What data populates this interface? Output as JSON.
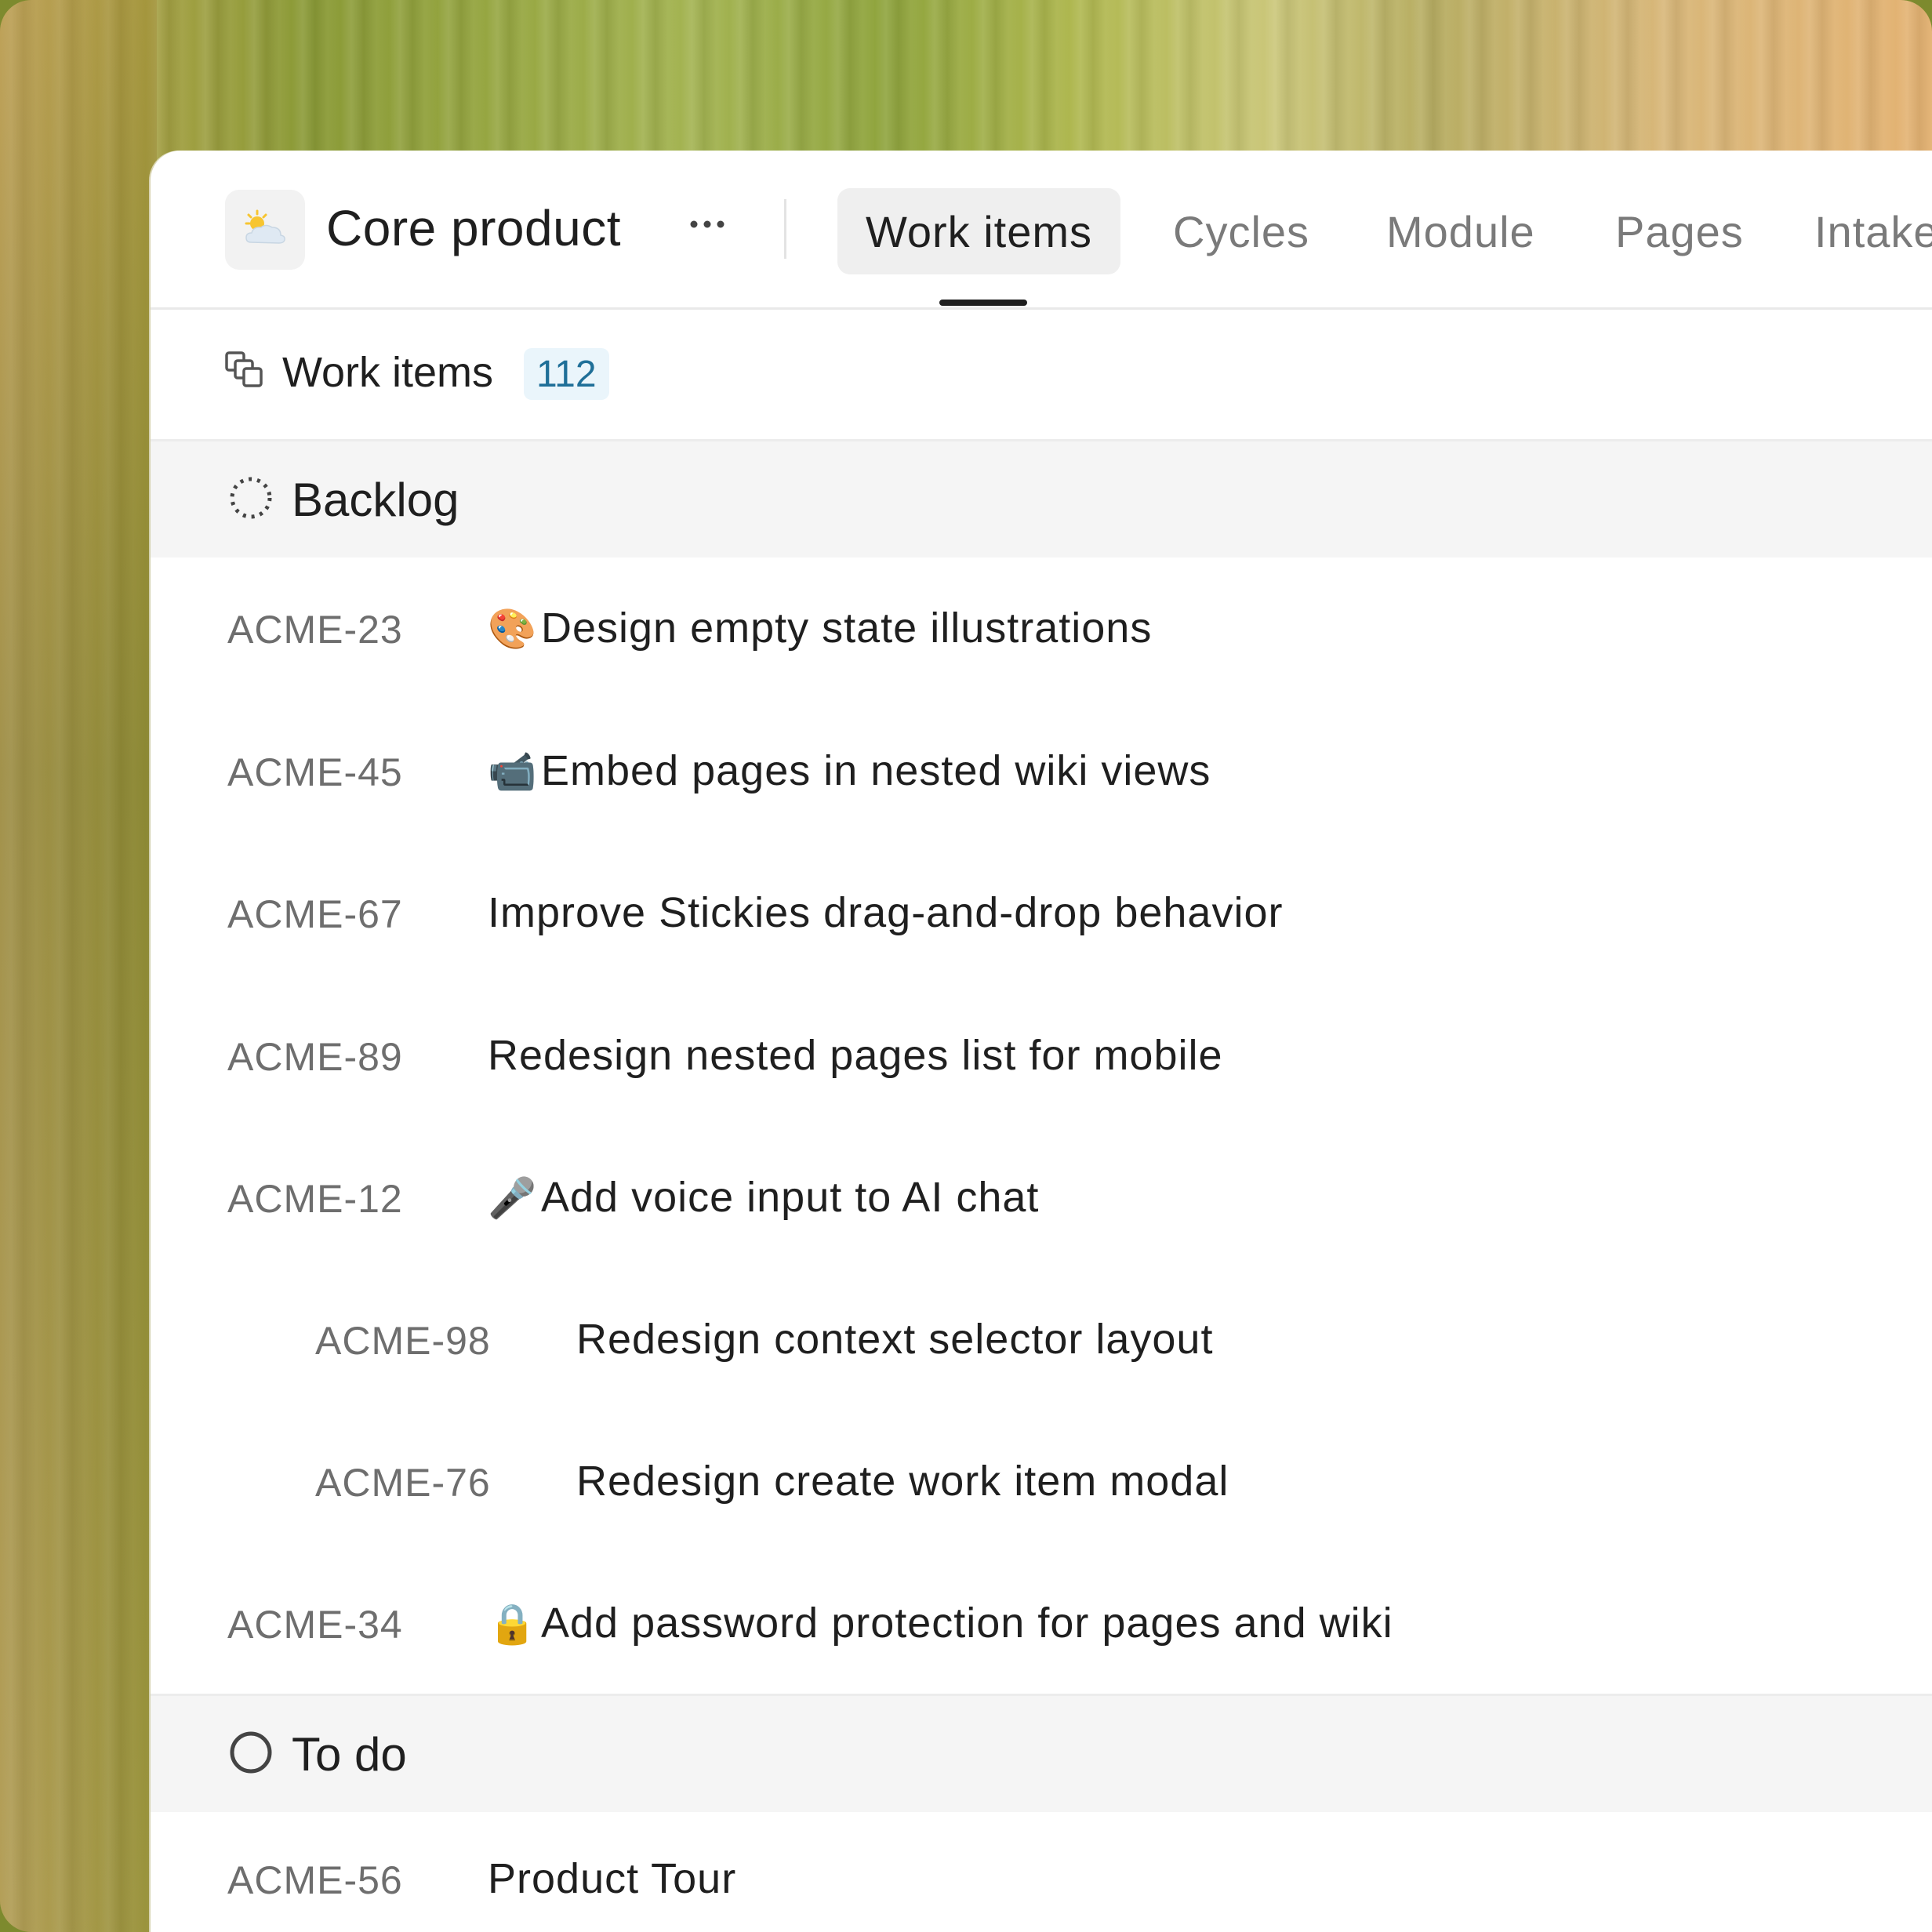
{
  "project": {
    "icon": "sun-behind-cloud-icon",
    "name": "Core product",
    "more_label": "···"
  },
  "tabs": [
    {
      "label": "Work items",
      "active": true
    },
    {
      "label": "Cycles",
      "active": false
    },
    {
      "label": "Module",
      "active": false
    },
    {
      "label": "Pages",
      "active": false
    },
    {
      "label": "Intake",
      "active": false
    }
  ],
  "work_items": {
    "icon": "layers-icon",
    "title": "Work items",
    "count": "112"
  },
  "groups": [
    {
      "name": "Backlog",
      "icon": "dashed-circle-icon",
      "items": [
        {
          "id": "ACME-23",
          "emoji": "🎨",
          "emoji_name": "palette-icon",
          "title": "Design empty state illustrations",
          "level": 0
        },
        {
          "id": "ACME-45",
          "emoji": "📹",
          "emoji_name": "video-camera-icon",
          "title": "Embed pages in nested wiki views",
          "level": 0
        },
        {
          "id": "ACME-67",
          "emoji": "",
          "title": "Improve Stickies drag-and-drop behavior",
          "level": 0
        },
        {
          "id": "ACME-89",
          "emoji": "",
          "title": "Redesign nested pages list for mobile",
          "level": 0
        },
        {
          "id": "ACME-12",
          "emoji": "🎤",
          "emoji_name": "microphone-icon",
          "title": "Add voice input to AI chat",
          "level": 0
        },
        {
          "id": "ACME-98",
          "emoji": "",
          "title": "Redesign context selector layout",
          "level": 1
        },
        {
          "id": "ACME-76",
          "emoji": "",
          "title": "Redesign create work item modal",
          "level": 1
        },
        {
          "id": "ACME-34",
          "emoji": "🔒",
          "emoji_name": "lock-icon",
          "title": "Add password protection for pages and wiki",
          "level": 0
        }
      ]
    },
    {
      "name": "To do",
      "icon": "empty-circle-icon",
      "items": [
        {
          "id": "ACME-56",
          "emoji": "",
          "title": "Product Tour",
          "level": 0
        }
      ]
    }
  ],
  "colors": {
    "accent_badge_bg": "#eaf5fb",
    "accent_badge_text": "#1f6f98",
    "group_bg": "#f5f5f5"
  }
}
